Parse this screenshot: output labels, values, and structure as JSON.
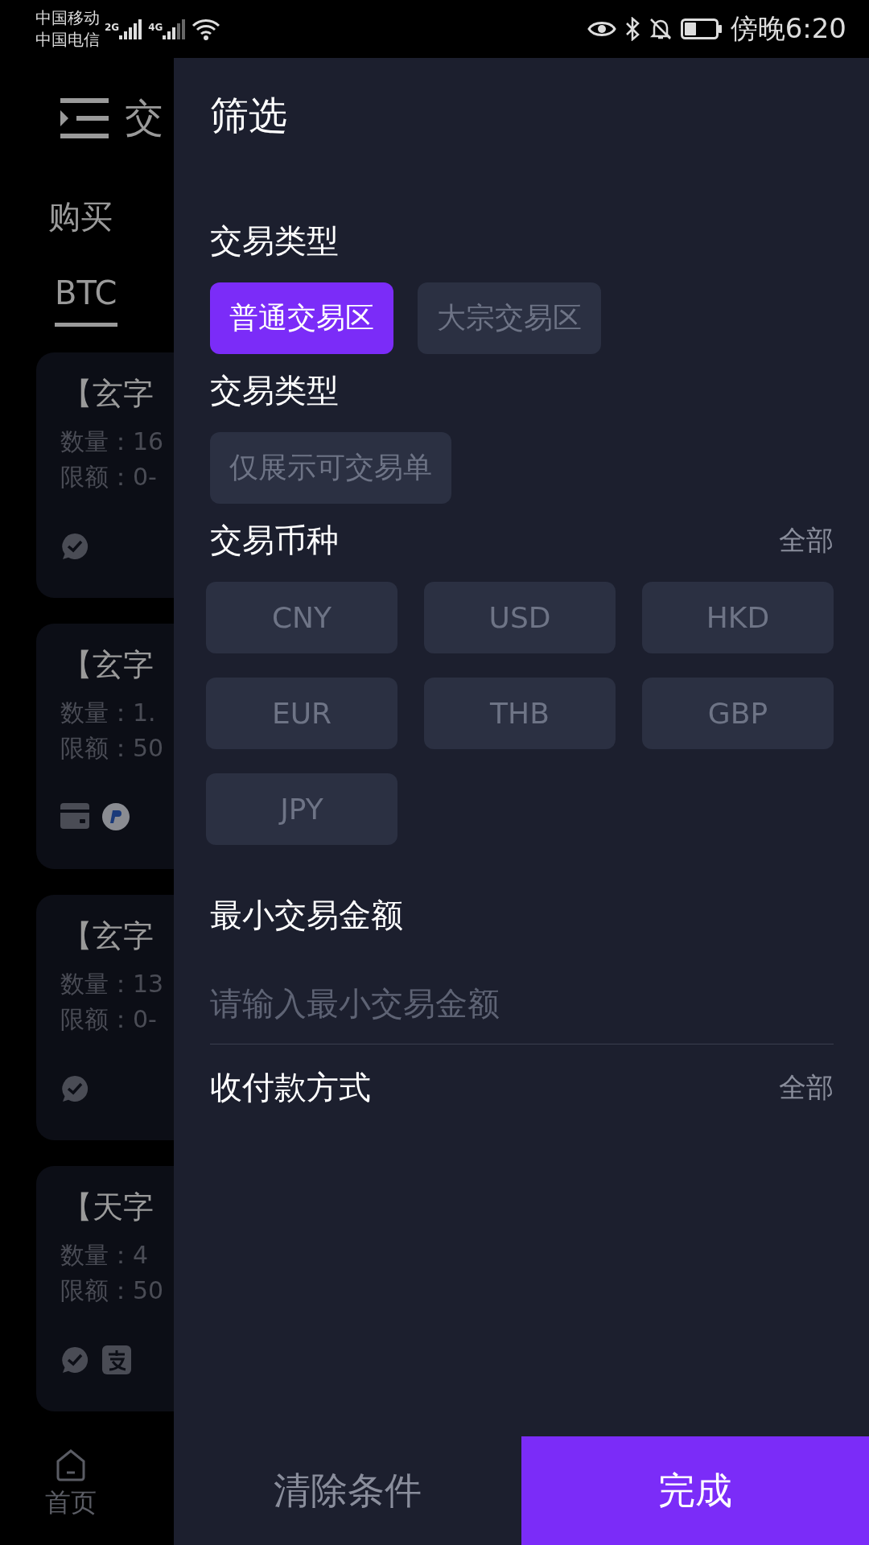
{
  "status_bar": {
    "carriers": [
      "中国移动",
      "中国电信"
    ],
    "networks": [
      {
        "label": "2G"
      },
      {
        "label": "4G"
      }
    ],
    "time": "傍晚6:20"
  },
  "background_page": {
    "title": "交",
    "tabs": [
      {
        "label": "购买"
      }
    ],
    "coins": [
      {
        "label": "BTC",
        "selected": true
      }
    ],
    "listings": [
      {
        "name": "【玄字",
        "quantity": "数量：16",
        "limit": "限额：0-",
        "payments": [
          {
            "kind": "chat"
          }
        ]
      },
      {
        "name": "【玄字",
        "quantity": "数量：1.",
        "limit": "限额：50",
        "payments": [
          {
            "kind": "card"
          },
          {
            "kind": "coin"
          }
        ]
      },
      {
        "name": "【玄字",
        "quantity": "数量：13",
        "limit": "限额：0-",
        "payments": [
          {
            "kind": "chat"
          }
        ]
      },
      {
        "name": "【天字",
        "quantity": "数量：4",
        "limit": "限额：50",
        "payments": [
          {
            "kind": "chat"
          },
          {
            "kind": "square"
          }
        ]
      }
    ],
    "bottom_nav": [
      {
        "label": "首页"
      }
    ]
  },
  "filter": {
    "title": "筛选",
    "sections": [
      {
        "kind": "chips",
        "heading": "交易类型",
        "options": [
          {
            "label": "普通交易区",
            "selected": true
          },
          {
            "label": "大宗交易区",
            "selected": false
          }
        ]
      },
      {
        "kind": "chips",
        "heading": "交易类型",
        "options": [
          {
            "label": "仅展示可交易单",
            "selected": false
          }
        ]
      },
      {
        "kind": "grid",
        "heading": "交易币种",
        "action": "全部",
        "options": [
          {
            "label": "CNY",
            "selected": false
          },
          {
            "label": "USD",
            "selected": false
          },
          {
            "label": "HKD",
            "selected": false
          },
          {
            "label": "EUR",
            "selected": false
          },
          {
            "label": "THB",
            "selected": false
          },
          {
            "label": "GBP",
            "selected": false
          },
          {
            "label": "JPY",
            "selected": false
          }
        ]
      },
      {
        "kind": "input",
        "heading": "最小交易金额",
        "placeholder": "请输入最小交易金额"
      },
      {
        "kind": "link",
        "heading": "收付款方式",
        "action": "全部"
      }
    ],
    "buttons": [
      {
        "label": "清除条件",
        "kind": "secondary"
      },
      {
        "label": "完成",
        "kind": "primary"
      }
    ]
  }
}
